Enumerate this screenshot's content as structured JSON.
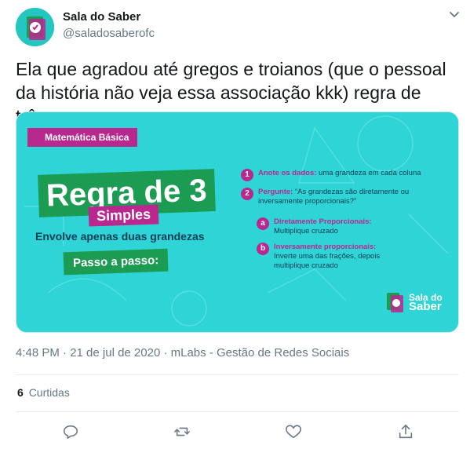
{
  "user": {
    "name": "Sala do Saber",
    "handle": "@saladosaberofc"
  },
  "tweet": {
    "text": "Ela que agradou até gregos e troianos (que o pessoal da história não veja essa associação kkk) regra de três.",
    "timestamp": "4:48 PM · 21 de jul de 2020 · mLabs - Gestão de Redes Sociais"
  },
  "media": {
    "tag": "Matemática Básica",
    "headline": "Regra de 3",
    "subheadline": "Simples",
    "description": "Envolve apenas duas grandezas",
    "cta": "Passo a passo:",
    "steps": [
      {
        "marker": "1",
        "title": "Anote os dados:",
        "text": " uma grandeza em cada coluna"
      },
      {
        "marker": "2",
        "title": "Pergunte:",
        "text": " “As grandezas são diretamente ou inversamente proporcionais?”"
      },
      {
        "marker": "a",
        "title": "Diretamente Proporcionais:",
        "text": "Multiplique cruzado"
      },
      {
        "marker": "b",
        "title": "Inversamente proporcionais:",
        "text": "Inverte uma das frações, depois multiplique cruzado"
      }
    ],
    "brand_line1": "Sala do",
    "brand_line2": "Saber"
  },
  "engagement": {
    "likes_count": "6",
    "likes_label": "Curtidas"
  },
  "actions": [
    "reply-icon",
    "retweet-icon",
    "like-icon",
    "share-icon"
  ],
  "colors": {
    "accent_magenta": "#b8288f",
    "accent_green": "#1c9b52",
    "image_bg": "#2fd4d6",
    "muted_text": "#657786"
  }
}
